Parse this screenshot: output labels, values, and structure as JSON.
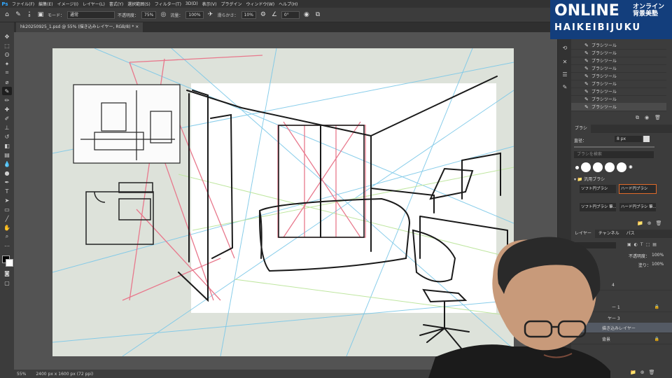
{
  "menubar": {
    "items": [
      "ファイル(F)",
      "編集(E)",
      "イメージ(I)",
      "レイヤー(L)",
      "書式(Y)",
      "選択範囲(S)",
      "フィルター(T)",
      "3D(D)",
      "表示(V)",
      "プラグイン",
      "ウィンドウ(W)",
      "ヘルプ(H)"
    ]
  },
  "options": {
    "mode_label": "モード：",
    "mode_value": "通常",
    "opacity_label": "不透明度：",
    "opacity_value": "75%",
    "flow_label": "流量：",
    "flow_value": "100%",
    "smoothing_label": "滑らかさ：",
    "smoothing_value": "10%",
    "angle_value": "0°",
    "brush_size": "8"
  },
  "document": {
    "tab_title": "hk20250925_1.psd @ 55% (描き込みレイヤー, RGB/8) *"
  },
  "status": {
    "zoom": "55%",
    "dimensions": "2400 px x 1600 px (72 ppi)"
  },
  "history": {
    "items": [
      "ブラシツール",
      "ブラシツール",
      "ブラシツール",
      "ブラシツール",
      "ブラシツール",
      "ブラシツール",
      "ブラシツール",
      "ブラシツール",
      "ブラシツール"
    ]
  },
  "brush_panel": {
    "title": "ブラシ",
    "size_label": "直径：",
    "size_value": "8 px",
    "search_placeholder": "ブラシを検索",
    "group_name": "汎用ブラシ",
    "brushes": [
      "ソフト円ブラシ",
      "ハード円ブラシ",
      "ソフト円ブラシ 筆...",
      "ハード円ブラシ 筆..."
    ]
  },
  "layers_panel": {
    "tabs": [
      "レイヤー",
      "チャンネル",
      "パス"
    ],
    "opacity_label": "不透明度：",
    "opacity_value": "100%",
    "fill_label": "塗り：",
    "fill_value": "100%",
    "layers": [
      {
        "name": "4"
      },
      {
        "name": "ー 1"
      },
      {
        "name": "ヤー 3"
      },
      {
        "name": "描き込みレイヤー"
      },
      {
        "name": "背景"
      }
    ]
  },
  "brand": {
    "title": "ONLINE",
    "jp_line1": "オンライン",
    "jp_line2": "背景美塾",
    "subtitle": "HAIKEIBIJUKU"
  },
  "colors": {
    "ui_dark": "#323232",
    "ui_panel": "#3c3c3c",
    "canvas_bg": "#535353",
    "brand_blue": "#133e7c",
    "accent_selected": "#e06a2a"
  }
}
